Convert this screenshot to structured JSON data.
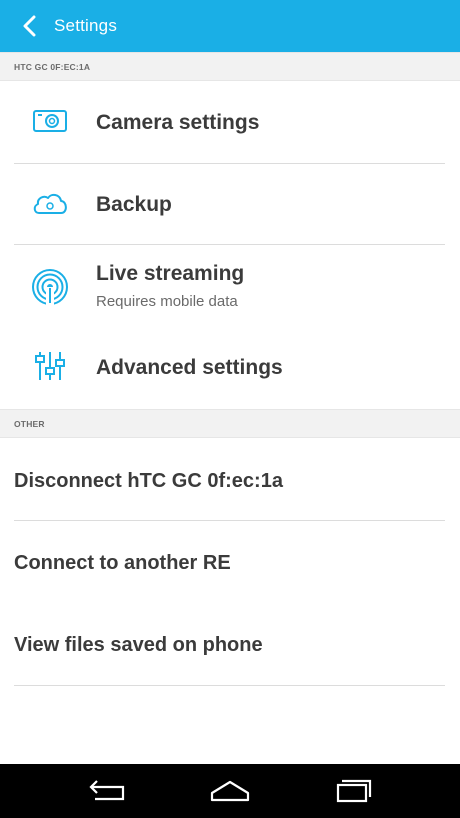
{
  "app_bar": {
    "title": "Settings",
    "back_icon": "chevron-left-icon",
    "color": "#1aafe6"
  },
  "section_device": {
    "header": "HTC GC 0F:EC:1A",
    "items": [
      {
        "label": "Camera settings",
        "sublabel": "",
        "icon": "camera-icon"
      },
      {
        "label": "Backup",
        "sublabel": "",
        "icon": "cloud-icon"
      },
      {
        "label": "Live streaming",
        "sublabel": "Requires mobile data",
        "icon": "broadcast-icon"
      },
      {
        "label": "Advanced settings",
        "sublabel": "",
        "icon": "sliders-icon"
      }
    ]
  },
  "section_other": {
    "header": "OTHER",
    "items": [
      {
        "label": "Disconnect hTC GC 0f:ec:1a"
      },
      {
        "label": "Connect to another RE"
      },
      {
        "label": "View files saved on phone"
      }
    ]
  },
  "nav_bar": {
    "icons": [
      "back-nav-icon",
      "home-nav-icon",
      "recents-nav-icon"
    ]
  },
  "accent_color": "#1aafe6"
}
